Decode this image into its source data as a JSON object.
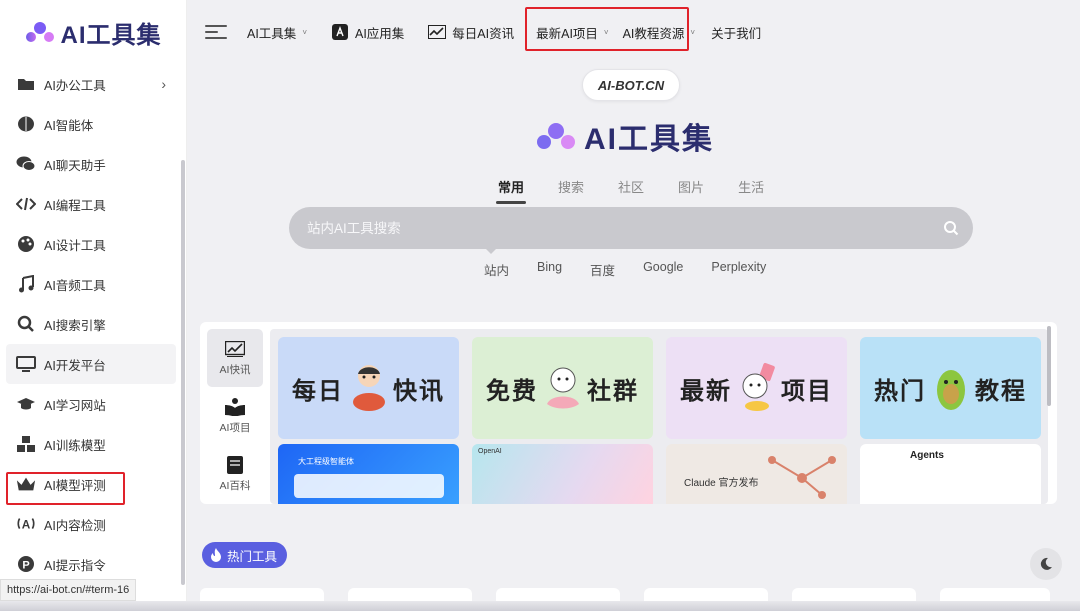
{
  "logo": {
    "text": "AI工具集"
  },
  "sidebar": {
    "items": [
      {
        "label": "AI办公工具",
        "icon": "folder-icon",
        "has_arrow": true
      },
      {
        "label": "AI智能体",
        "icon": "brain-icon"
      },
      {
        "label": "AI聊天助手",
        "icon": "chat-bubbles-icon"
      },
      {
        "label": "AI编程工具",
        "icon": "code-icon"
      },
      {
        "label": "AI设计工具",
        "icon": "palette-icon"
      },
      {
        "label": "AI音频工具",
        "icon": "music-note-icon"
      },
      {
        "label": "AI搜索引擎",
        "icon": "search-icon"
      },
      {
        "label": "AI开发平台",
        "icon": "monitor-icon",
        "active": true
      },
      {
        "label": "AI学习网站",
        "icon": "graduation-cap-icon"
      },
      {
        "label": "AI训练模型",
        "icon": "cubes-icon"
      },
      {
        "label": "AI模型评测",
        "icon": "crown-icon",
        "highlighted": true
      },
      {
        "label": "AI内容检测",
        "icon": "broadcast-icon"
      },
      {
        "label": "AI提示指令",
        "icon": "p-circle-icon"
      }
    ],
    "arrow": "›"
  },
  "topnav": {
    "items": [
      {
        "label": "AI工具集",
        "caret": true
      },
      {
        "label": "AI应用集",
        "icon": "app-store-icon"
      },
      {
        "label": "每日AI资讯",
        "icon": "chart-line-icon"
      },
      {
        "label": "最新AI项目",
        "caret": true
      },
      {
        "label": "AI教程资源",
        "caret": true
      },
      {
        "label": "关于我们"
      }
    ],
    "caret": "˅"
  },
  "hero": {
    "badge": "AI-BOT.CN",
    "title": "AI工具集"
  },
  "search": {
    "tabs": [
      "常用",
      "搜索",
      "社区",
      "图片",
      "生活"
    ],
    "active_tab": "常用",
    "placeholder": "站内AI工具搜索",
    "engines": [
      "站内",
      "Bing",
      "百度",
      "Google",
      "Perplexity"
    ]
  },
  "panel": {
    "tabs": [
      {
        "label": "AI快讯",
        "icon": "chart-line-icon",
        "active": true
      },
      {
        "label": "AI项目",
        "icon": "open-book-icon"
      },
      {
        "label": "AI百科",
        "icon": "book-icon"
      }
    ],
    "cards": [
      {
        "left": "每日",
        "right": "快讯",
        "bg": "#c9daf8"
      },
      {
        "left": "免费",
        "right": "社群",
        "bg": "#dcefd4"
      },
      {
        "left": "最新",
        "right": "项目",
        "bg": "#ede0f5"
      },
      {
        "left": "热门",
        "right": "教程",
        "bg": "#b9e1f7"
      }
    ],
    "preview_cards": [
      {
        "label": "大工程级智能体",
        "bg": "#2d7bf4"
      },
      {
        "label": "OpenAI",
        "bg": "#9bd6e4"
      },
      {
        "label": "Claude 官方发布",
        "bg": "#efe9e4"
      },
      {
        "label": "Agents",
        "bg": "#ffffff"
      }
    ]
  },
  "hot": {
    "label": "热门工具"
  },
  "status_url": "https://ai-bot.cn/#term-16",
  "colors": {
    "accent": "#5a5fe0",
    "highlight": "#e0222a",
    "brand_text": "#2b2d6e"
  }
}
